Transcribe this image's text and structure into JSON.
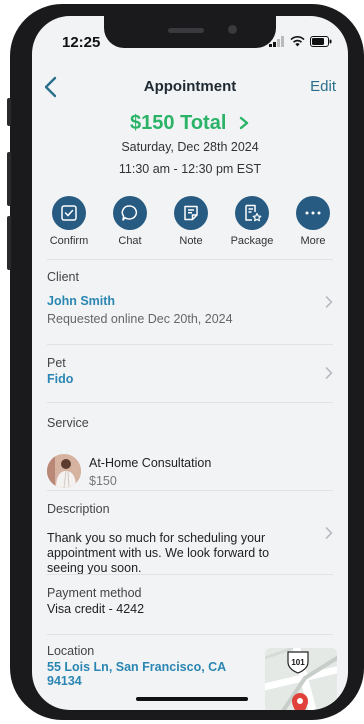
{
  "status_bar": {
    "time": "12:25"
  },
  "nav": {
    "title": "Appointment",
    "edit_label": "Edit"
  },
  "summary": {
    "total": "$150 Total",
    "date": "Saturday, Dec 28th 2024",
    "time_range": "11:30 am - 12:30 pm EST"
  },
  "actions": [
    {
      "label": "Confirm",
      "icon": "checkbox-icon"
    },
    {
      "label": "Chat",
      "icon": "chat-bubble-icon"
    },
    {
      "label": "Note",
      "icon": "note-icon"
    },
    {
      "label": "Package",
      "icon": "package-icon"
    },
    {
      "label": "More",
      "icon": "more-dots-icon"
    }
  ],
  "client": {
    "label": "Client",
    "name": "John Smith",
    "requested": "Requested online Dec 20th, 2024"
  },
  "pet": {
    "label": "Pet",
    "name": "Fido"
  },
  "service": {
    "label": "Service",
    "name": "At-Home Consultation",
    "price": "$150"
  },
  "description": {
    "label": "Description",
    "line1": "Thank you so much for scheduling your",
    "line2": "appointment with us. We look forward to",
    "line3": "seeing you soon."
  },
  "payment": {
    "label": "Payment method",
    "value": "Visa credit - 4242"
  },
  "location": {
    "label": "Location",
    "line1": "55 Lois Ln, San Francisco, CA",
    "line2": "94134",
    "map_route_label": "101"
  },
  "colors": {
    "accent_green": "#2bb368",
    "action_blue": "#275b82",
    "link_blue": "#2a86b2"
  }
}
